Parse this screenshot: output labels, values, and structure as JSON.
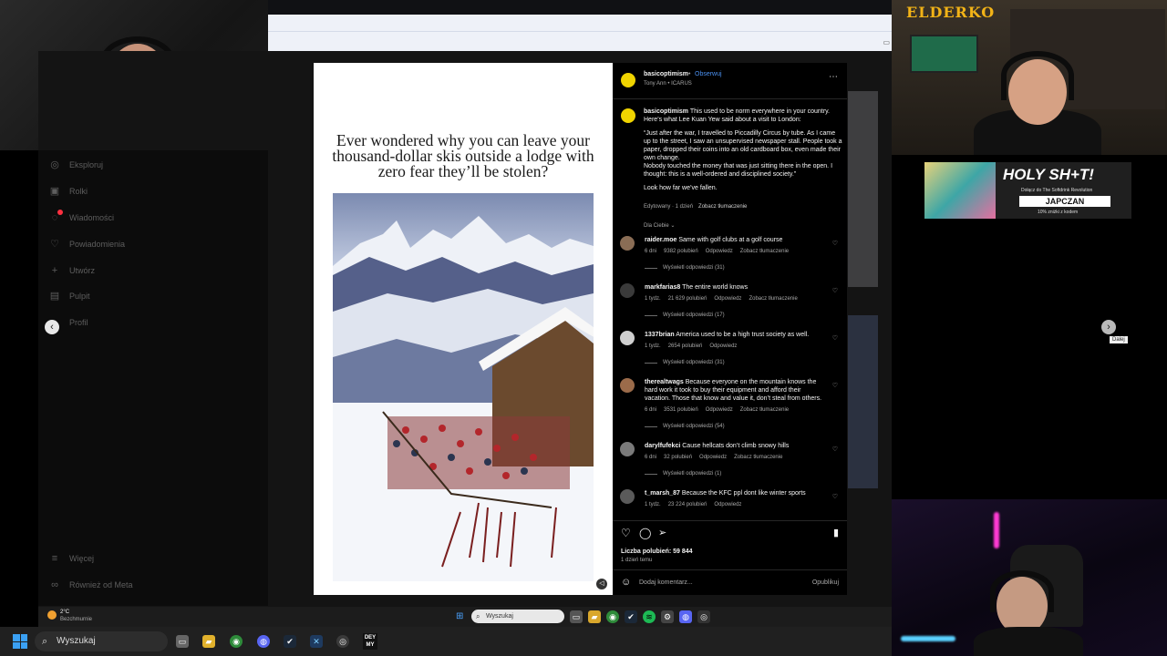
{
  "stream": {
    "brand_logo": "ELDERKO",
    "ad": {
      "headline": "HOLY SH+T!",
      "subline": "Dołącz do The Softdrink Revolution",
      "code_label": "JAPCZAN",
      "discount": "10% zniżki z kodem"
    }
  },
  "sidebar": {
    "items": [
      {
        "label": "Eksploruj",
        "icon": "compass-icon"
      },
      {
        "label": "Rolki",
        "icon": "reels-icon"
      },
      {
        "label": "Wiadomości",
        "icon": "messenger-icon"
      },
      {
        "label": "Powiadomienia",
        "icon": "heart-icon"
      },
      {
        "label": "Utwórz",
        "icon": "plus-icon"
      },
      {
        "label": "Pulpit",
        "icon": "dashboard-icon"
      },
      {
        "label": "Profil",
        "icon": "profile-icon"
      }
    ],
    "bottom": [
      {
        "label": "Więcej",
        "icon": "menu-icon"
      },
      {
        "label": "Również od Meta",
        "icon": "meta-icon"
      }
    ]
  },
  "carousel": {
    "next_tooltip": "Dalej"
  },
  "post": {
    "headline": "Ever wondered why you can leave your thousand-dollar skis outside a lodge with zero fear they’ll be stolen?",
    "author": "basicoptimism",
    "follow": "Obserwuj",
    "audio": "Tony Ann • ICARUS",
    "caption_author": "basicoptimism",
    "caption_lines": [
      "This used to be norm everywhere in your country. Here’s what Lee Kuan Yew said about a visit to London:",
      "“Just after the war, I travelled to Piccadilly Circus by tube. As I came up to the street, I saw an unsupervised newspaper stall. People took a paper, dropped their coins into an old cardboard box, even made their own change.",
      "Nobody touched the money that was just sitting there in the open. I thought: this is a well-ordered and disciplined society.”",
      "Look how far we’ve fallen."
    ],
    "caption_meta": "Edytowany · 1 dzień",
    "caption_translate": "Zobacz tłumaczenie",
    "sort_label": "Dla Ciebie",
    "likes": "Liczba polubień: 59 844",
    "time": "1 dzień temu",
    "comment_placeholder": "Dodaj komentarz...",
    "publish": "Opublikuj"
  },
  "comments": [
    {
      "user": "raider.moe",
      "text": "Same with golf clubs at a golf course",
      "time": "6 dni",
      "likes": "9382 polubień",
      "reply": "Odpowiedz",
      "translate": "Zobacz tłumaczenie",
      "replies": "Wyświetl odpowiedzi (31)",
      "avatar_color": "#8a6d55"
    },
    {
      "user": "markfarias8",
      "text": "The entire world knows",
      "time": "1 tydz.",
      "likes": "21 629 polubień",
      "reply": "Odpowiedz",
      "translate": "Zobacz tłumaczenie",
      "replies": "Wyświetl odpowiedzi (17)",
      "avatar_color": "#3a3a3a"
    },
    {
      "user": "1337brian",
      "text": "America used to be a high trust society as well.",
      "time": "1 tydz.",
      "likes": "2654 polubień",
      "reply": "Odpowiedz",
      "translate": "",
      "replies": "Wyświetl odpowiedzi (31)",
      "avatar_color": "#cfcfcf"
    },
    {
      "user": "therealtwags",
      "text": "Because everyone on the mountain knows the hard work it took to buy their equipment and afford their vacation. Those that know and value it, don’t steal from others.",
      "time": "6 dni",
      "likes": "3531 polubień",
      "reply": "Odpowiedz",
      "translate": "Zobacz tłumaczenie",
      "replies": "Wyświetl odpowiedzi (54)",
      "avatar_color": "#9b6b4a"
    },
    {
      "user": "darylfufekci",
      "text": "Cause hellcats don’t climb snowy hills",
      "time": "6 dni",
      "likes": "32 polubień",
      "reply": "Odpowiedz",
      "translate": "Zobacz tłumaczenie",
      "replies": "Wyświetl odpowiedzi (1)",
      "avatar_color": "#7a7a7a"
    },
    {
      "user": "t_marsh_87",
      "text": "Because the KFC ppl dont like winter sports",
      "time": "1 tydz.",
      "likes": "23 224 polubień",
      "reply": "Odpowiedz",
      "translate": "",
      "replies": "",
      "avatar_color": "#5a5a5a"
    }
  ],
  "taskbar": {
    "weather_temp": "2°C",
    "weather_desc": "Bezchmurnie",
    "search_inner": "Wyszukaj",
    "search_outer": "Wyszukaj",
    "app_label": "DEY MY"
  }
}
